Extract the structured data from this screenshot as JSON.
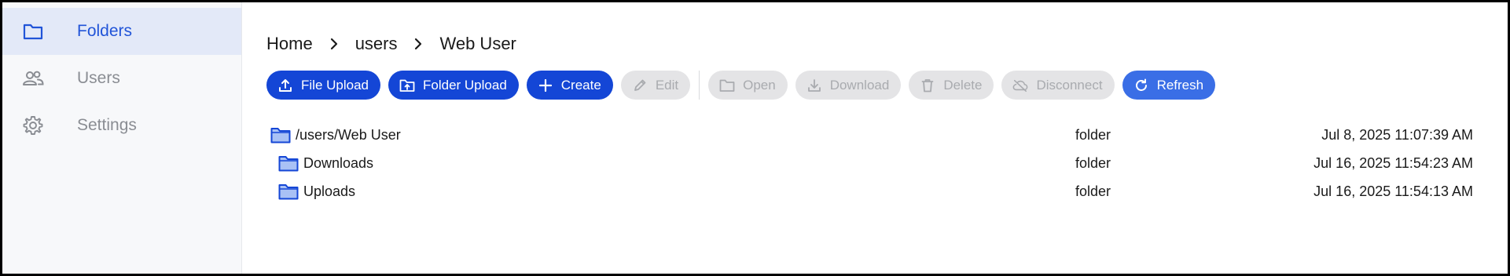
{
  "sidebar": {
    "items": [
      {
        "label": "Folders",
        "icon": "folder-icon",
        "active": true
      },
      {
        "label": "Users",
        "icon": "users-icon",
        "active": false
      },
      {
        "label": "Settings",
        "icon": "gear-icon",
        "active": false
      }
    ]
  },
  "breadcrumb": [
    "Home",
    "users",
    "Web User"
  ],
  "toolbar": {
    "file_upload": "File Upload",
    "folder_upload": "Folder Upload",
    "create": "Create",
    "edit": "Edit",
    "open": "Open",
    "download": "Download",
    "delete": "Delete",
    "disconnect": "Disconnect",
    "refresh": "Refresh"
  },
  "files": [
    {
      "name": "/users/Web User",
      "type": "folder",
      "date": "Jul 8, 2025 11:07:39 AM"
    },
    {
      "name": "Downloads",
      "type": "folder",
      "date": "Jul 16, 2025 11:54:23 AM"
    },
    {
      "name": "Uploads",
      "type": "folder",
      "date": "Jul 16, 2025 11:54:13 AM"
    }
  ],
  "colors": {
    "primary": "#1446d6",
    "refresh": "#3a6ee6",
    "active_nav_bg": "#e3e9f8",
    "active_nav_text": "#2154d8",
    "folder_fill": "#a9c1f5",
    "folder_stroke": "#1446d6"
  }
}
